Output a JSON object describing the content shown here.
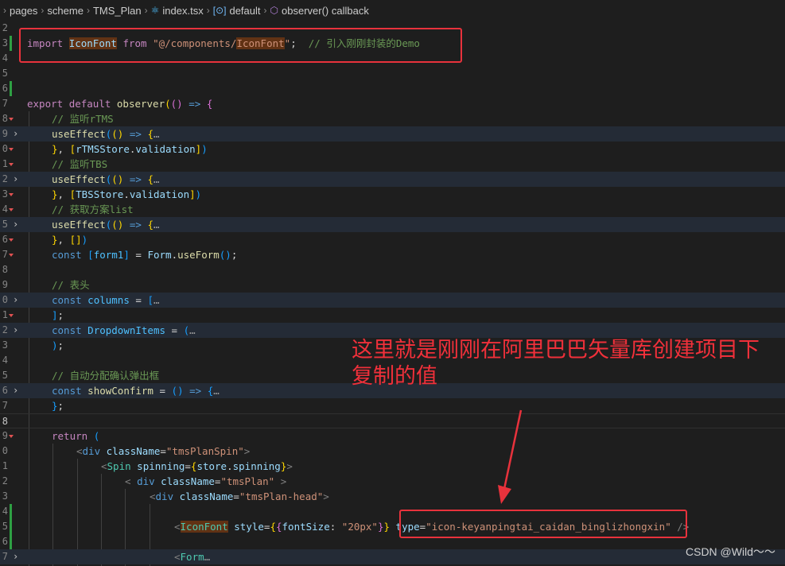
{
  "breadcrumb": {
    "items": [
      "pages",
      "scheme",
      "TMS_Plan",
      "index.tsx",
      "default",
      "observer() callback"
    ]
  },
  "gutter": {
    "line_numbers": [
      "2",
      "3",
      "4",
      "5",
      "6",
      "7",
      "8",
      "9",
      "0",
      "1",
      "2",
      "3",
      "4",
      "5",
      "6",
      "7",
      "8",
      "9",
      "0",
      "1",
      "2",
      "3",
      "4",
      "5",
      "6",
      "7",
      "8",
      "9",
      "0",
      "1",
      "2",
      "3",
      "4",
      "5",
      "6",
      "7",
      "8",
      "9"
    ]
  },
  "code": {
    "import_line": {
      "kw_import": "import",
      "name": "IconFont",
      "kw_from": "from",
      "str_open": "\"@/components/",
      "str_match": "IconFont",
      "str_close": "\"",
      "semi": ";",
      "comment": "// 引入刚刚封装的Demo"
    },
    "export_kw": "export",
    "default_kw": "default",
    "observer_fn": "observer",
    "arrow": "=>",
    "comment_rtms": "// 监听rTMS",
    "comment_tbs": "// 监听TBS",
    "comment_list": "// 获取方案list",
    "use_effect": "useEffect",
    "fold_ellipsis": "…",
    "rtms_store": "rTMSStore",
    "tbs_store": "TBSStore",
    "validation": "validation",
    "const_kw": "const",
    "form1": "form1",
    "form_obj": "Form",
    "use_form": "useForm",
    "comment_header": "// 表头",
    "columns": "columns",
    "dropdown_items": "DropdownItems",
    "comment_confirm": "// 自动分配确认弹出框",
    "show_confirm": "showConfirm",
    "return_kw": "return",
    "div_tag": "div",
    "class_name_attr": "className",
    "cls_spin": "\"tmsPlanSpin\"",
    "spin_tag": "Spin",
    "spinning_attr": "spinning",
    "store_var": "store",
    "spinning_prop": "spinning",
    "cls_plan": "\"tmsPlan\"",
    "cls_head": "\"tmsPlan-head\"",
    "iconfont_tag": "IconFont",
    "style_attr": "style",
    "font_size_key": "fontSize",
    "font_size_val": "\"20px\"",
    "type_attr": "type",
    "type_val": "\"icon-keyanpingtai_caidan_binglizhongxin\"",
    "form_tag": "Form"
  },
  "annotation": {
    "line1": "这里就是刚刚在阿里巴巴矢量库创建项目下",
    "line2": "复制的值"
  },
  "watermark": "CSDN @Wild～～",
  "colors": {
    "annotation_red": "#e8323c",
    "editor_bg": "#1e1e1e"
  }
}
